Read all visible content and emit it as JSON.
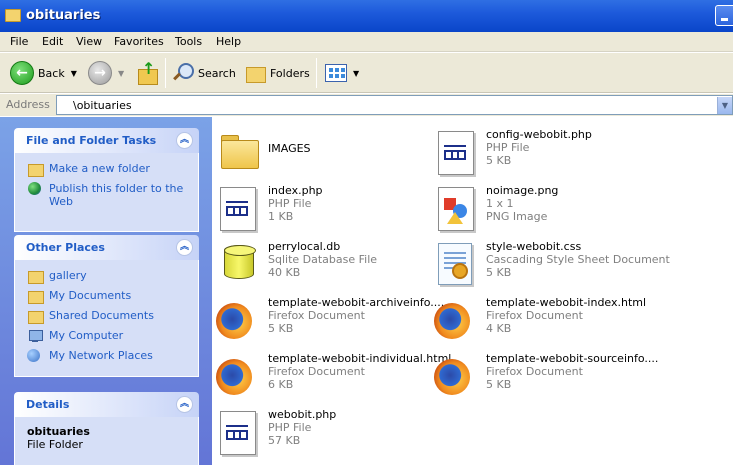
{
  "window": {
    "title": "obituaries"
  },
  "menu": [
    "File",
    "Edit",
    "View",
    "Favorites",
    "Tools",
    "Help"
  ],
  "toolbar": {
    "back": "Back",
    "search": "Search",
    "folders": "Folders"
  },
  "address": {
    "label": "Address",
    "value": "\\obituaries"
  },
  "panels": {
    "tasks": {
      "title": "File and Folder Tasks",
      "items": [
        "Make a new folder",
        "Publish this folder to the Web"
      ]
    },
    "places": {
      "title": "Other Places",
      "items": [
        "gallery",
        "My Documents",
        "Shared Documents",
        "My Computer",
        "My Network Places"
      ]
    },
    "details": {
      "title": "Details",
      "name": "obituaries",
      "type": "File Folder"
    }
  },
  "files": [
    {
      "name": "IMAGES",
      "type": "",
      "size": "",
      "icon": "folder-icon"
    },
    {
      "name": "config-webobit.php",
      "type": "PHP File",
      "size": "5 KB",
      "icon": "php-file-icon"
    },
    {
      "name": "index.php",
      "type": "PHP File",
      "size": "1 KB",
      "icon": "php-file-icon"
    },
    {
      "name": "noimage.png",
      "type": "1 x 1",
      "size": "PNG Image",
      "icon": "image-file-icon"
    },
    {
      "name": "perrylocal.db",
      "type": "Sqlite Database File",
      "size": "40 KB",
      "icon": "database-icon"
    },
    {
      "name": "style-webobit.css",
      "type": "Cascading Style Sheet Document",
      "size": "5 KB",
      "icon": "css-file-icon"
    },
    {
      "name": "template-webobit-archiveinfo....",
      "type": "Firefox Document",
      "size": "5 KB",
      "icon": "firefox-icon"
    },
    {
      "name": "template-webobit-index.html",
      "type": "Firefox Document",
      "size": "4 KB",
      "icon": "firefox-icon"
    },
    {
      "name": "template-webobit-individual.html",
      "type": "Firefox Document",
      "size": "6 KB",
      "icon": "firefox-icon"
    },
    {
      "name": "template-webobit-sourceinfo....",
      "type": "Firefox Document",
      "size": "5 KB",
      "icon": "firefox-icon"
    },
    {
      "name": "webobit.php",
      "type": "PHP File",
      "size": "57 KB",
      "icon": "php-file-icon"
    }
  ]
}
